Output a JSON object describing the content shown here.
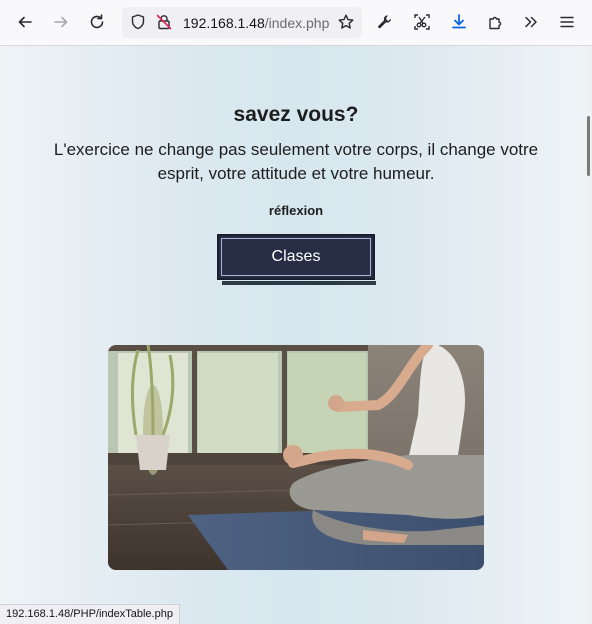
{
  "browser": {
    "url_host": "192.168.1.48",
    "url_path": "/index.php",
    "status_url": "192.168.1.48/PHP/indexTable.php",
    "icons": [
      "back-icon",
      "forward-icon",
      "reload-icon",
      "shield-icon",
      "insecure-lock-icon",
      "bookmark-star-icon",
      "wrench-icon",
      "screenshot-icon",
      "download-icon",
      "extensions-icon",
      "overflow-chevrons-icon",
      "menu-icon"
    ]
  },
  "content": {
    "headline": "savez vous?",
    "quote": "L'exercice ne change pas seulement votre corps, il change votre esprit, votre attitude et votre humeur.",
    "reflexion": "réflexion",
    "cta_label": "Clases"
  },
  "colors": {
    "button_bg": "#262d45",
    "page_gradient": "#d6e7ef",
    "download_accent": "#0061e0"
  }
}
